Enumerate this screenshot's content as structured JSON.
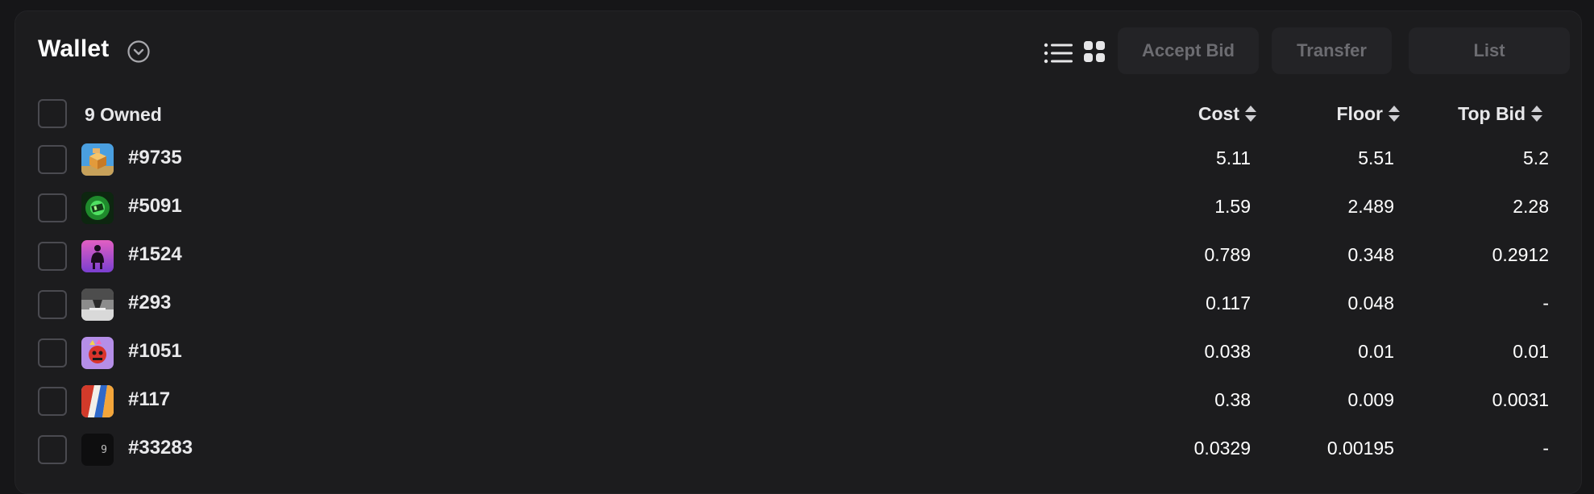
{
  "header": {
    "title": "Wallet",
    "buttons": {
      "accept_bid": "Accept Bid",
      "transfer": "Transfer",
      "list": "List"
    }
  },
  "table": {
    "owned_label": "9 Owned",
    "columns": {
      "cost": "Cost",
      "floor": "Floor",
      "top_bid": "Top Bid"
    },
    "rows": [
      {
        "token": "#9735",
        "cost": "5.11",
        "floor": "5.51",
        "top_bid": "5.2",
        "thumb_icon": "orange-box-nft-icon"
      },
      {
        "token": "#5091",
        "cost": "1.59",
        "floor": "2.489",
        "top_bid": "2.28",
        "thumb_icon": "green-glow-nft-icon"
      },
      {
        "token": "#1524",
        "cost": "0.789",
        "floor": "0.348",
        "top_bid": "0.2912",
        "thumb_icon": "pink-silhouette-nft-icon"
      },
      {
        "token": "#293",
        "cost": "0.117",
        "floor": "0.048",
        "top_bid": "-",
        "thumb_icon": "gray-scene-nft-icon"
      },
      {
        "token": "#1051",
        "cost": "0.038",
        "floor": "0.01",
        "top_bid": "0.01",
        "thumb_icon": "purple-character-nft-icon"
      },
      {
        "token": "#117",
        "cost": "0.38",
        "floor": "0.009",
        "top_bid": "0.0031",
        "thumb_icon": "abstract-stripes-nft-icon"
      },
      {
        "token": "#33283",
        "cost": "0.0329",
        "floor": "0.00195",
        "top_bid": "-",
        "thumb_icon": "dark-number-nft-icon",
        "thumb_text": "9"
      }
    ]
  },
  "colors": {
    "background": "#161618",
    "panel": "#1c1c1e",
    "button_bg": "#232326",
    "button_text": "#6c6c71",
    "text": "#ffffff"
  }
}
